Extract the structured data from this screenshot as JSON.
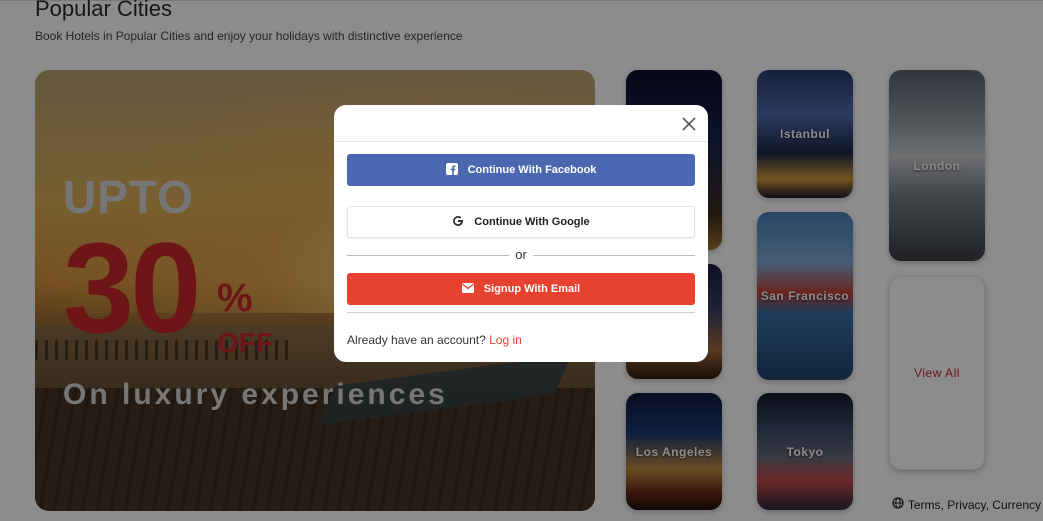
{
  "section": {
    "title": "Popular Cities",
    "subtitle": "Book Hotels in Popular Cities and enjoy your holidays with distinctive experience"
  },
  "hero": {
    "upto": "UPTO",
    "discount": "30",
    "percent": "%",
    "off": "OFF",
    "tagline": "On luxury experiences"
  },
  "cities": {
    "istanbul": "Istanbul",
    "london": "London",
    "san_francisco": "San Francisco",
    "los_angeles": "Los Angeles",
    "tokyo": "Tokyo",
    "view_all": "View All"
  },
  "footer": {
    "links": "Terms, Privacy, Currency"
  },
  "modal": {
    "facebook_label": "Continue With Facebook",
    "google_label": "Continue With Google",
    "or_label": "or",
    "email_label": "Signup With Email",
    "already_text": "Already have an account?",
    "login_label": "Log in"
  },
  "colors": {
    "facebook": "#4a67b0",
    "email": "#e8412f",
    "accent_red": "#c8272a"
  },
  "icons": {
    "close": "close-icon",
    "facebook": "facebook-icon",
    "google": "google-icon",
    "email": "email-icon",
    "globe": "globe-icon"
  }
}
